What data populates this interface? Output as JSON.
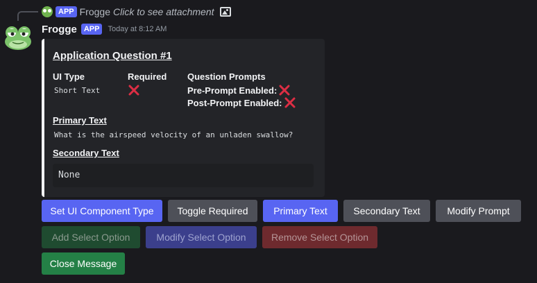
{
  "reply": {
    "badge": "APP",
    "author": "Frogge",
    "text": "Click to see attachment",
    "attachment_icon": "image-icon"
  },
  "message": {
    "author": "Frogge",
    "badge": "APP",
    "timestamp": "Today at 8:12 AM",
    "avatar_icon": "frog-avatar"
  },
  "embed": {
    "title": "Application Question #1",
    "accent_color": "#f2f3f5",
    "ui_type_label": "UI Type",
    "ui_type_value": "Short Text",
    "required_label": "Required",
    "required_value_icon": "cross-mark-icon",
    "prompts_label": "Question Prompts",
    "pre_prompt_label": "Pre-Prompt Enabled:",
    "post_prompt_label": "Post-Prompt Enabled:",
    "primary_text_label": "Primary Text",
    "primary_text_value": "What is the airspeed velocity of an unladen swallow?",
    "secondary_text_label": "Secondary Text",
    "secondary_text_value": "None"
  },
  "buttons": {
    "row1": [
      {
        "label": "Set UI Component Type",
        "style": "primary"
      },
      {
        "label": "Toggle Required",
        "style": "secondary"
      },
      {
        "label": "Primary Text",
        "style": "primary"
      },
      {
        "label": "Secondary Text",
        "style": "secondary"
      },
      {
        "label": "Modify Prompt",
        "style": "secondary"
      }
    ],
    "row2": [
      {
        "label": "Add Select Option",
        "style": "success",
        "disabled": true
      },
      {
        "label": "Modify Select Option",
        "style": "primary",
        "disabled": true
      },
      {
        "label": "Remove Select Option",
        "style": "danger",
        "disabled": true
      }
    ],
    "row3": [
      {
        "label": "Close Message",
        "style": "success"
      }
    ]
  },
  "colors": {
    "primary": "#5865f2",
    "secondary": "#4e5058",
    "success": "#248046",
    "danger": "#da373c",
    "cross": "#dd2e44"
  }
}
